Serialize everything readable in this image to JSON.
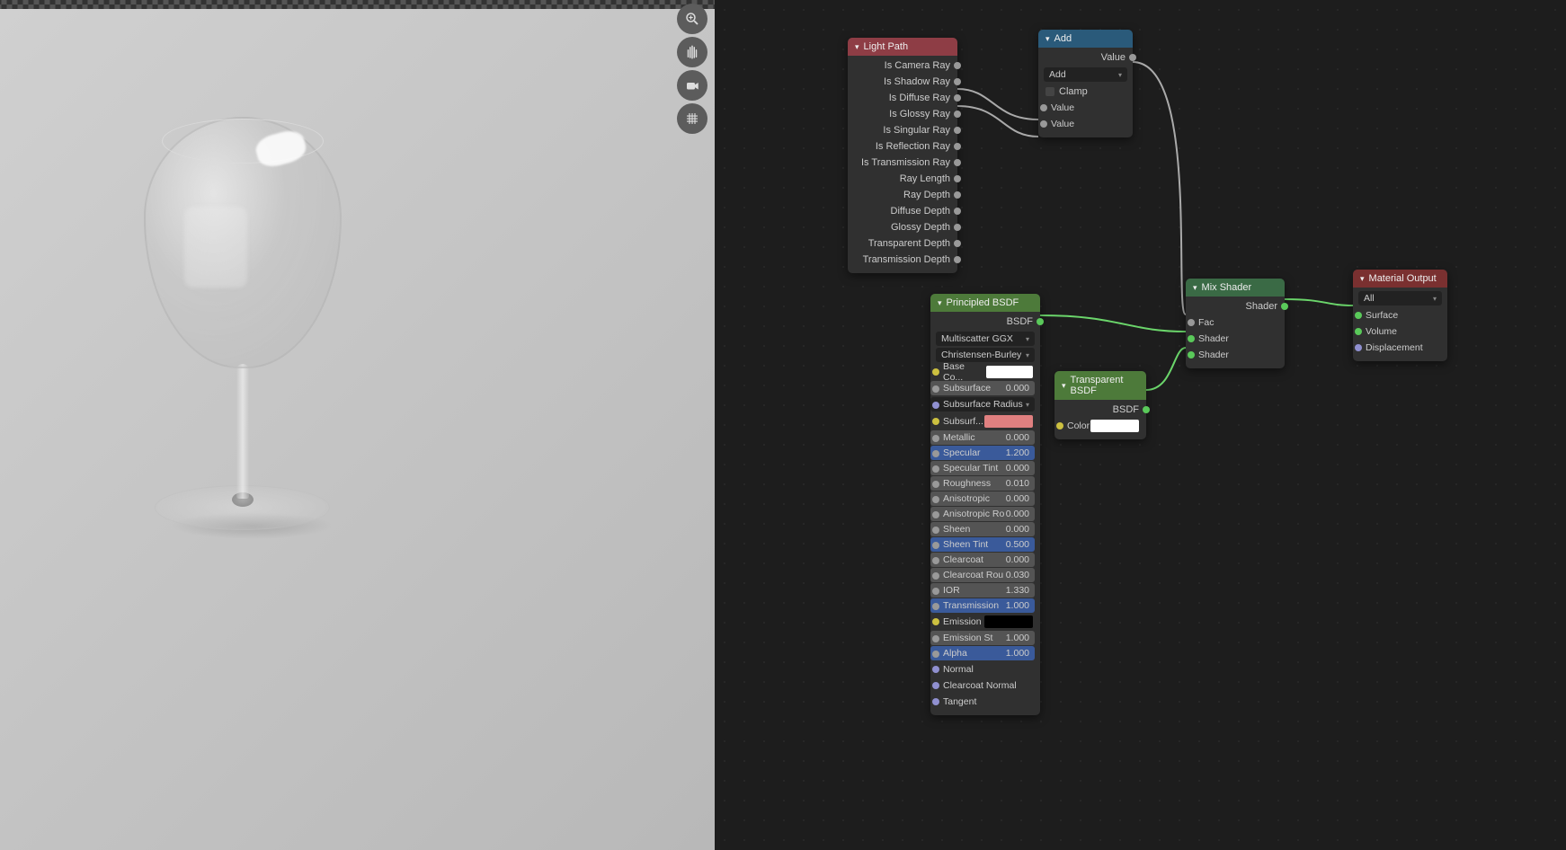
{
  "tools": [
    "zoom",
    "pan",
    "camera",
    "grid"
  ],
  "lightpath": {
    "title": "Light Path",
    "outs": [
      "Is Camera Ray",
      "Is Shadow Ray",
      "Is Diffuse Ray",
      "Is Glossy Ray",
      "Is Singular Ray",
      "Is Reflection Ray",
      "Is Transmission Ray",
      "Ray Length",
      "Ray Depth",
      "Diffuse Depth",
      "Glossy Depth",
      "Transparent Depth",
      "Transmission Depth"
    ]
  },
  "add": {
    "title": "Add",
    "out": "Value",
    "mode": "Add",
    "clamp": "Clamp",
    "in1": "Value",
    "in2": "Value"
  },
  "principled": {
    "title": "Principled BSDF",
    "out": "BSDF",
    "dd1": "Multiscatter GGX",
    "dd2": "Christensen-Burley",
    "baseColLabel": "Base Co...",
    "params": [
      {
        "l": "Subsurface",
        "v": "0.000",
        "c": "grey"
      },
      {
        "l": "Subsurface Radius",
        "v": "",
        "dd": true,
        "c": "purple"
      },
      {
        "l": "Subsurf...",
        "v": "",
        "sw": "pink",
        "c": "yellow"
      },
      {
        "l": "Metallic",
        "v": "0.000",
        "c": "grey"
      },
      {
        "l": "Specular",
        "v": "1.200",
        "c": "grey",
        "blue": true
      },
      {
        "l": "Specular Tint",
        "v": "0.000",
        "c": "grey"
      },
      {
        "l": "Roughness",
        "v": "0.010",
        "c": "grey"
      },
      {
        "l": "Anisotropic",
        "v": "0.000",
        "c": "grey"
      },
      {
        "l": "Anisotropic Ro",
        "v": "0.000",
        "c": "grey"
      },
      {
        "l": "Sheen",
        "v": "0.000",
        "c": "grey"
      },
      {
        "l": "Sheen Tint",
        "v": "0.500",
        "c": "grey",
        "blue": true
      },
      {
        "l": "Clearcoat",
        "v": "0.000",
        "c": "grey"
      },
      {
        "l": "Clearcoat Rou",
        "v": "0.030",
        "c": "grey"
      },
      {
        "l": "IOR",
        "v": "1.330",
        "c": "grey"
      },
      {
        "l": "Transmission",
        "v": "1.000",
        "c": "grey",
        "blue": true
      },
      {
        "l": "Emission",
        "v": "",
        "sw": "black",
        "c": "yellow"
      },
      {
        "l": "Emission St",
        "v": "1.000",
        "c": "grey"
      },
      {
        "l": "Alpha",
        "v": "1.000",
        "c": "grey",
        "blue": true
      }
    ],
    "tail": [
      "Normal",
      "Clearcoat Normal",
      "Tangent"
    ]
  },
  "transparent": {
    "title": "Transparent BSDF",
    "out": "BSDF",
    "colorLabel": "Color"
  },
  "mix": {
    "title": "Mix Shader",
    "out": "Shader",
    "ins": [
      "Fac",
      "Shader",
      "Shader"
    ]
  },
  "matout": {
    "title": "Material Output",
    "dd": "All",
    "ins": [
      "Surface",
      "Volume",
      "Displacement"
    ]
  }
}
